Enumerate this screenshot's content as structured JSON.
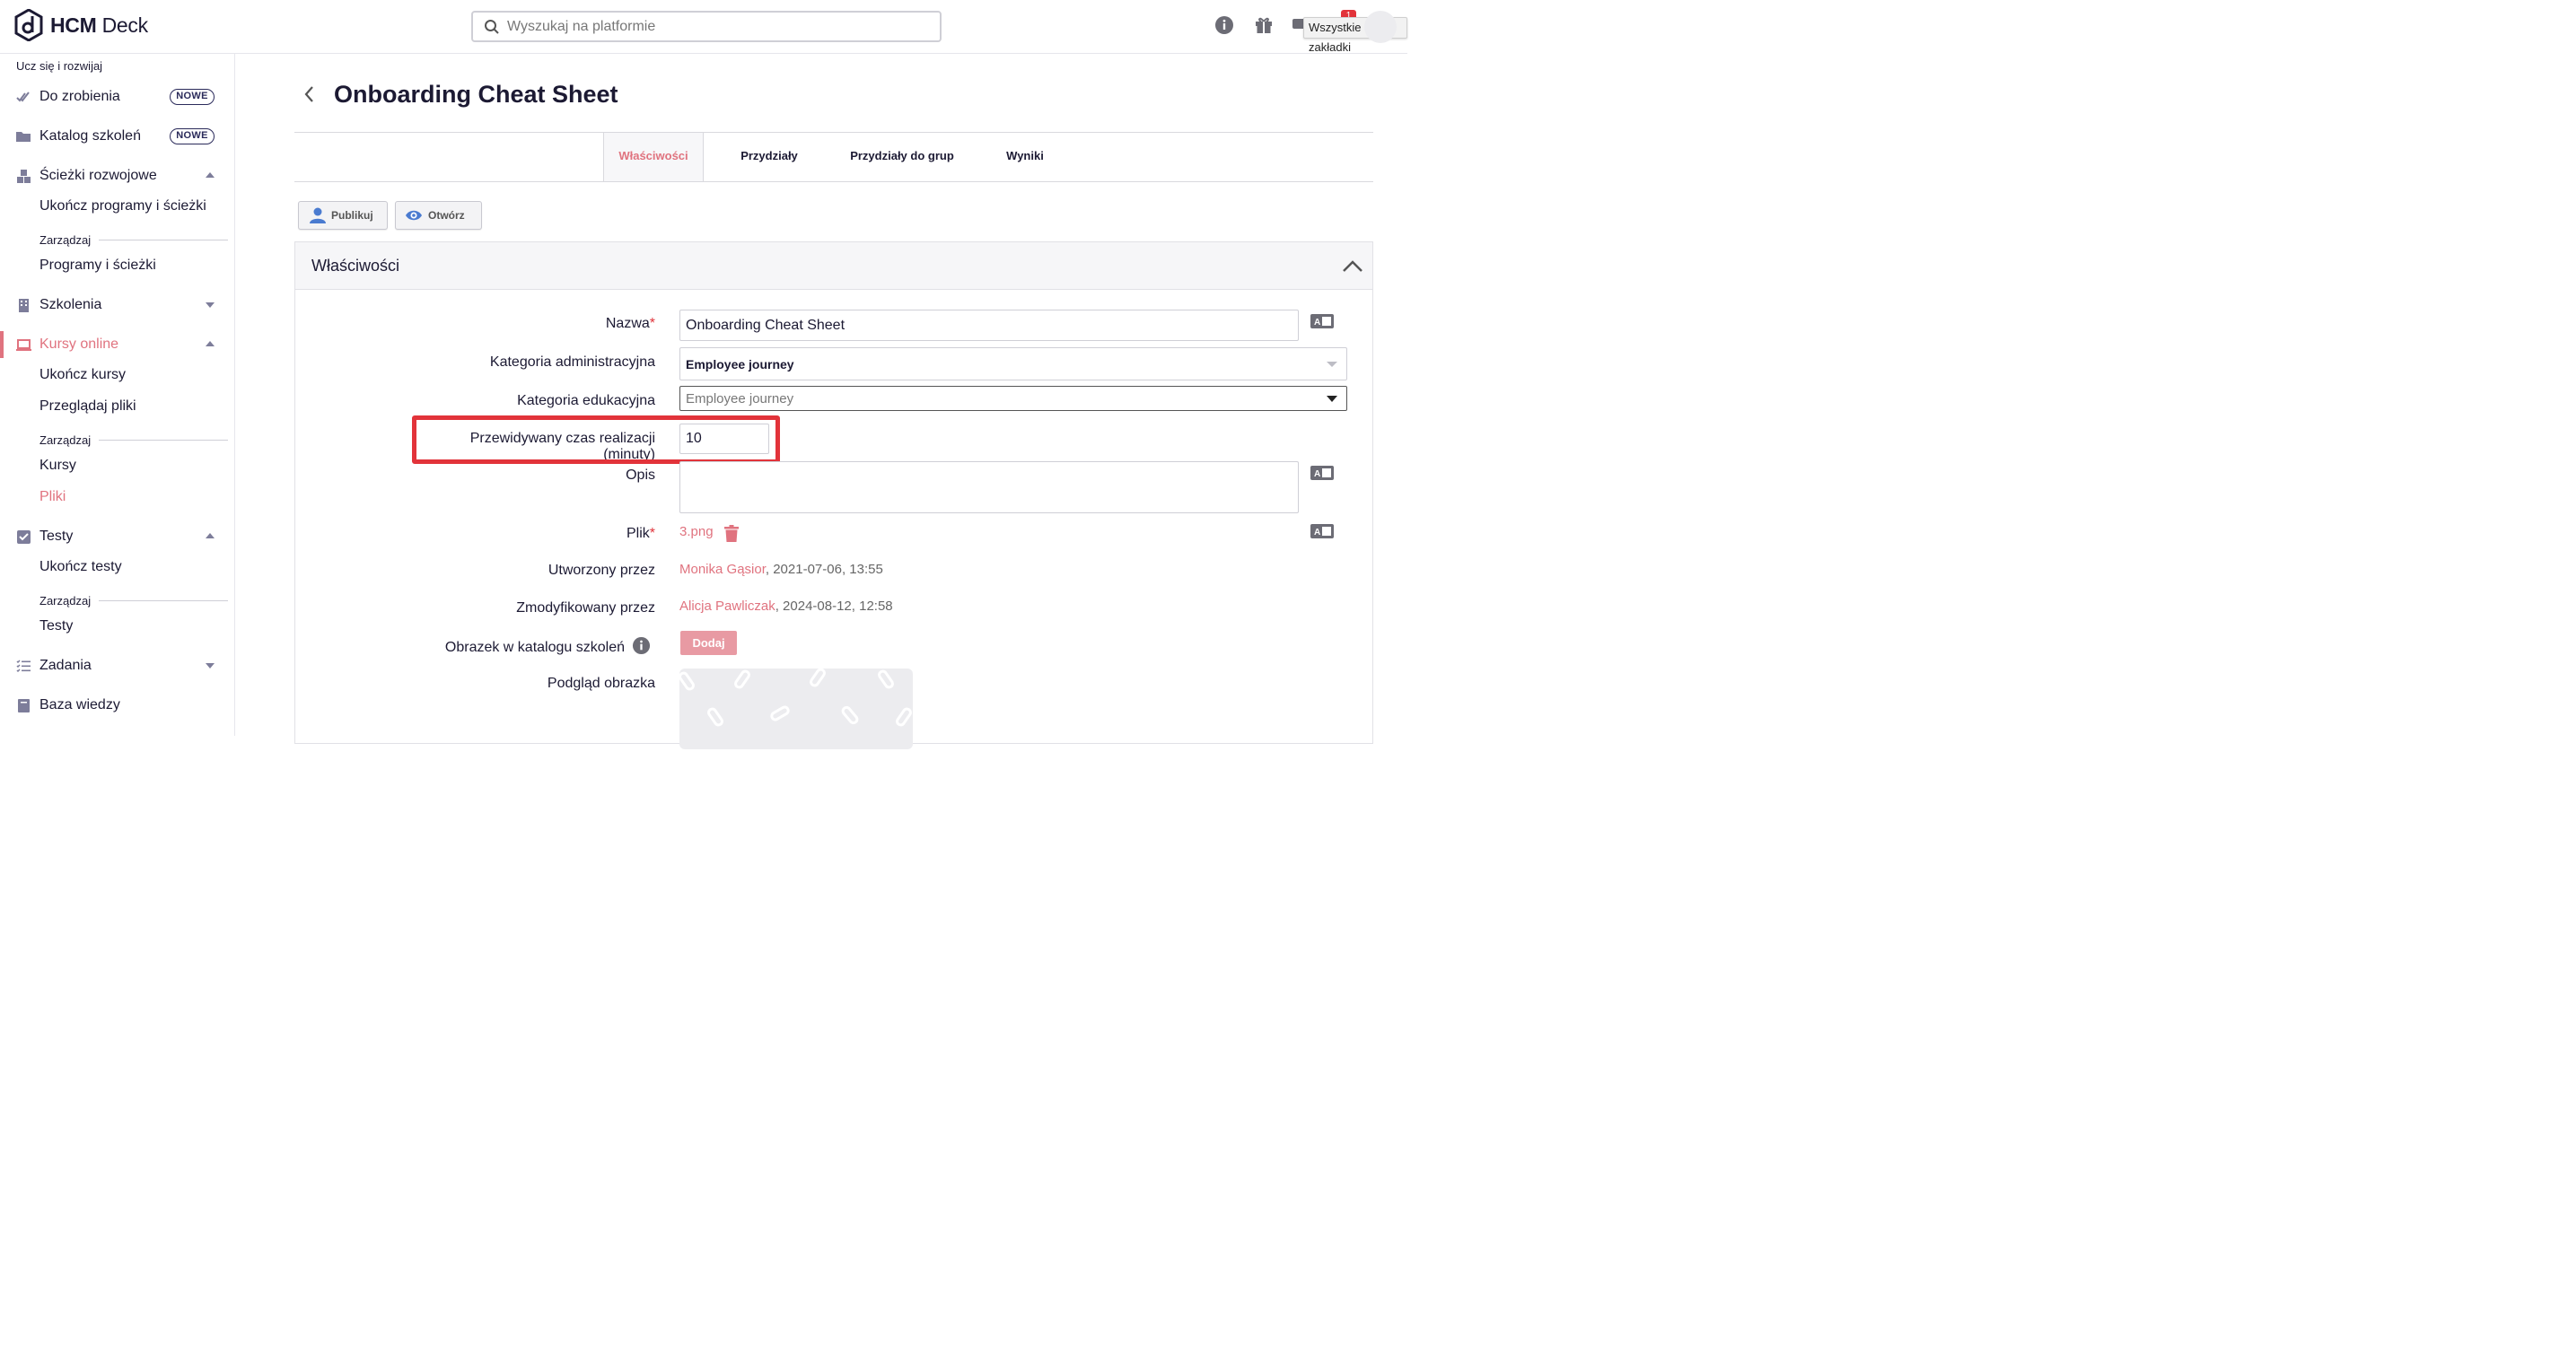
{
  "header": {
    "logo_brand": "HCM",
    "logo_product": "Deck",
    "search_placeholder": "Wyszukaj na platformie",
    "notification_count": "1",
    "tooltip": "Wszystkie zakładki",
    "icons": [
      "info-icon",
      "gift-icon",
      "chat-icon",
      "avatar"
    ]
  },
  "sidebar": {
    "section_label": "Ucz się i rozwijaj",
    "new_badge": "NOWE",
    "manage_label": "Zarządzaj",
    "items": [
      {
        "label": "Do zrobienia",
        "icon": "double-check-icon"
      },
      {
        "label": "Katalog szkoleń",
        "icon": "folder-icon"
      },
      {
        "label": "Ścieżki rozwojowe",
        "icon": "cubes-icon"
      },
      {
        "label": "Ukończ programy i ścieżki"
      },
      {
        "label": "Programy i ścieżki"
      },
      {
        "label": "Szkolenia",
        "icon": "building-icon"
      },
      {
        "label": "Kursy online",
        "icon": "laptop-icon"
      },
      {
        "label": "Ukończ kursy"
      },
      {
        "label": "Przeglądaj pliki"
      },
      {
        "label": "Kursy"
      },
      {
        "label": "Pliki"
      },
      {
        "label": "Testy",
        "icon": "checkbox-icon"
      },
      {
        "label": "Ukończ testy"
      },
      {
        "label": "Testy"
      },
      {
        "label": "Zadania",
        "icon": "list-icon"
      },
      {
        "label": "Baza wiedzy",
        "icon": "book-icon"
      }
    ]
  },
  "main": {
    "title": "Onboarding Cheat Sheet",
    "tabs": [
      "Właściwości",
      "Przydziały",
      "Przydziały do grup",
      "Wyniki"
    ],
    "active_tab": "Właściwości",
    "buttons": {
      "publish": "Publikuj",
      "open": "Otwórz"
    },
    "panel_title": "Właściwości",
    "form": {
      "name_label": "Nazwa",
      "name_value": "Onboarding Cheat Sheet",
      "admin_category_label": "Kategoria administracyjna",
      "admin_category_value": "Employee journey",
      "edu_category_label": "Kategoria edukacyjna",
      "edu_category_value": "Employee journey",
      "duration_label": "Przewidywany czas realizacji (minuty)",
      "duration_value": "10",
      "description_label": "Opis",
      "description_value": "",
      "file_label": "Plik",
      "file_value": "3.png",
      "created_label": "Utworzony przez",
      "created_by": "Monika Gąsior",
      "created_at": ", 2021-07-06, 13:55",
      "modified_label": "Zmodyfikowany przez",
      "modified_by": "Alicja Pawliczak",
      "modified_at": ", 2024-08-12, 12:58",
      "catalog_image_label": "Obrazek w katalogu szkoleń",
      "add_button": "Dodaj",
      "preview_label": "Podgląd obrazka"
    },
    "accent_color": "#e0737f",
    "highlight_color": "#e2333a"
  }
}
